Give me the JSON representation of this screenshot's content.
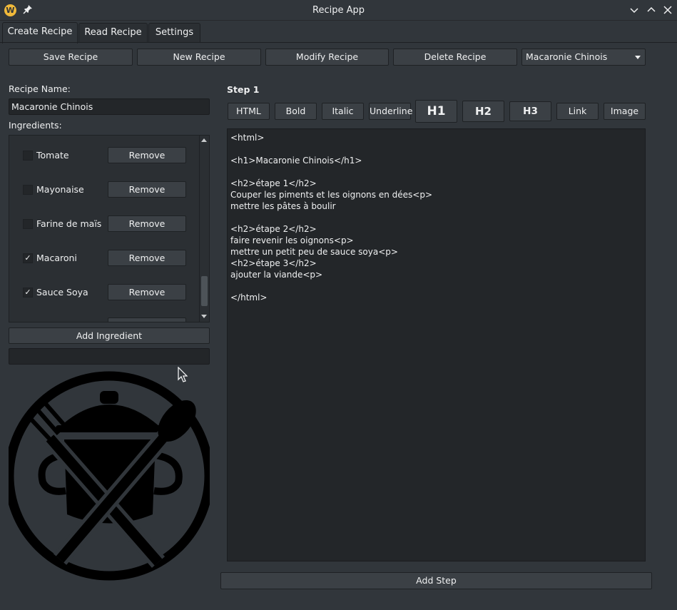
{
  "window": {
    "title": "Recipe App",
    "app_icon_letter": "W"
  },
  "tabs": [
    {
      "label": "Create Recipe",
      "active": true
    },
    {
      "label": "Read Recipe",
      "active": false
    },
    {
      "label": "Settings",
      "active": false
    }
  ],
  "toolbar": {
    "save_label": "Save Recipe",
    "new_label": "New Recipe",
    "modify_label": "Modify Recipe",
    "delete_label": "Delete Recipe",
    "recipe_select_value": "Macaronie Chinois"
  },
  "left": {
    "recipe_name_label": "Recipe Name:",
    "recipe_name_value": "Macaronie Chinois",
    "ingredients_label": "Ingredients:",
    "ingredients": [
      {
        "name": "Tomate",
        "checked": false,
        "check_glyph": "",
        "remove_label": "Remove"
      },
      {
        "name": "Mayonaise",
        "checked": false,
        "check_glyph": "",
        "remove_label": "Remove"
      },
      {
        "name": "Farine de maïs",
        "checked": false,
        "check_glyph": "",
        "remove_label": "Remove"
      },
      {
        "name": "Macaroni",
        "checked": true,
        "check_glyph": "✓",
        "remove_label": "Remove"
      },
      {
        "name": "Sauce Soya",
        "checked": true,
        "check_glyph": "✓",
        "remove_label": "Remove"
      }
    ],
    "add_ingredient_label": "Add Ingredient",
    "new_ingredient_value": ""
  },
  "right": {
    "step_title": "Step 1",
    "format_buttons": [
      "HTML",
      "Bold",
      "Italic",
      "Underline",
      "H1",
      "H2",
      "H3",
      "Link",
      "Image"
    ],
    "editor_text": "<html>\n\n<h1>Macaronie Chinois</h1>\n\n<h2>étape 1</h2>\nCouper les piments et les oignons en dées<p>\nmettre les pâtes à boulir\n\n<h2>étape 2</h2>\nfaire revenir les oignons<p>\nmettre un petit peu de sauce soya<p>\n<h2>étape 3</h2>\najouter la viande<p>\n\n</html>",
    "add_step_label": "Add Step"
  },
  "colors": {
    "background": "#31363b",
    "field": "#232629",
    "button": "#3b4045",
    "accent": "#f0b93a"
  }
}
